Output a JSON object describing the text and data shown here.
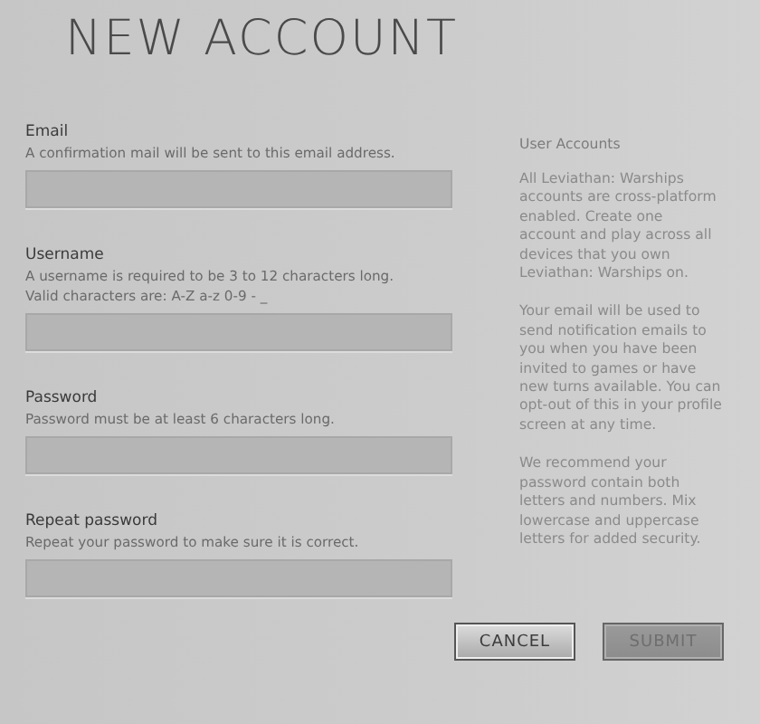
{
  "title": "NEW ACCOUNT",
  "fields": [
    {
      "label": "Email",
      "hint_lines": [
        "A confirmation mail will be sent to this email address."
      ]
    },
    {
      "label": "Username",
      "hint_lines": [
        "A username is required to be 3 to 12 characters long.",
        "Valid characters are: A-Z a-z 0-9 - _"
      ]
    },
    {
      "label": "Password",
      "hint_lines": [
        "Password must be at least 6 characters long."
      ]
    },
    {
      "label": "Repeat password",
      "hint_lines": [
        "Repeat your password to make sure it is correct."
      ]
    }
  ],
  "info": {
    "heading": "User Accounts",
    "paragraphs": [
      "All Leviathan: Warships accounts are cross-platform enabled. Create one account and play across all devices that you own Leviathan: Warships on.",
      "Your email will be used to send notification emails to you when you have been invited to games or have new turns available. You can opt-out of this in your profile screen at any time.",
      "We recommend your password contain both letters and numbers. Mix lowercase and uppercase letters for added security."
    ]
  },
  "buttons": [
    {
      "label": "CANCEL",
      "disabled": false
    },
    {
      "label": "SUBMIT",
      "disabled": true
    }
  ]
}
